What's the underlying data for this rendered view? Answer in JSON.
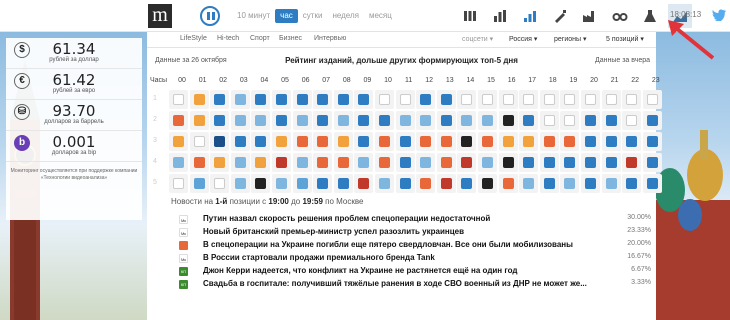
{
  "logo": "m",
  "periods": [
    "10 минут",
    "час",
    "сутки",
    "неделя",
    "месяц"
  ],
  "active_period": "час",
  "toolbar_icons": [
    "grid-icon",
    "bars-icon",
    "bars-blue-icon",
    "brush-icon",
    "factory-icon",
    "glasses-icon",
    "flask-icon",
    "chart-icon"
  ],
  "time": "18:08:13",
  "currency": [
    {
      "icon": "$",
      "value": "61.34",
      "desc": "рублей за доллар"
    },
    {
      "icon": "€",
      "value": "61.42",
      "desc": "рублей за евро"
    },
    {
      "icon": "⛁",
      "value": "93.70",
      "desc": "долларов за баррель"
    },
    {
      "icon": "b",
      "value": "0.001",
      "desc": "долларов за bip"
    }
  ],
  "currency_note": "Мониторинг осуществляется при поддержке компании «Технологии видеоанализа»",
  "categories": [
    "LifeStyle",
    "Hi-tech",
    "Спорт",
    "Бизнес",
    "Интервью"
  ],
  "filters": {
    "social": "соцсети",
    "country": "Россия",
    "regions": "регионы",
    "positions": "5 позиций"
  },
  "data_left": "Данные за 26 октября",
  "rating_title": "Рейтинг изданий, дольше других формирующих топ-5 дня",
  "data_right": "Данные за вчера",
  "hours_label": "Часы",
  "hours": [
    "00",
    "01",
    "02",
    "03",
    "04",
    "05",
    "06",
    "07",
    "08",
    "09",
    "10",
    "11",
    "12",
    "13",
    "14",
    "15",
    "16",
    "17",
    "18",
    "19",
    "20",
    "21",
    "22",
    "23"
  ],
  "row_labels": [
    "1",
    "2",
    "3",
    "4",
    "5"
  ],
  "news_head": {
    "prefix": "Новости на",
    "pos": "1-й",
    "mid": "позиции с",
    "from": "19:00",
    "to_word": "до",
    "to": "19:59",
    "suffix": "по Москве"
  },
  "news": [
    {
      "text": "Путин назвал скорость решения проблем спецоперации недостаточной",
      "pct": "30.00%",
      "color": "#ffffff",
      "icon": "Мк"
    },
    {
      "text": "Новый британский премьер-министр успел разозлить украинцев",
      "pct": "23.33%",
      "color": "#ffffff",
      "icon": "Мк"
    },
    {
      "text": "В спецоперации на Украине погибли еще пятеро свердловчан. Все они были мобилизованы",
      "pct": "20.00%",
      "color": "#e8683a",
      "icon": ""
    },
    {
      "text": "В России стартовали продажи премиального бренда Tank",
      "pct": "16.67%",
      "color": "#ffffff",
      "icon": "Мк"
    },
    {
      "text": "Джон Керри надеется, что конфликт на Украине не растянется ещё на один год",
      "pct": "6.67%",
      "color": "#3d8b2f",
      "icon": "КП"
    },
    {
      "text": "Свадьба в госпитале: получивший тяжёлые ранения в ходе СВО военный из ДНР не может же...",
      "pct": "3.33%",
      "color": "#3d8b2f",
      "icon": "КП"
    }
  ],
  "colors": {
    "accent": "#2e7dc2",
    "selected_icon_bg": "#dde8f2",
    "annotation_arrow": "#e0333a"
  },
  "grid_palette": [
    "#ffffff",
    "#f2a23c",
    "#2e7dc2",
    "#1b4f8a",
    "#7fb6e0",
    "#5ea3d8",
    "#e8683a",
    "#c0392b",
    "#3d8b2f",
    "#222222",
    "#6f6f6f",
    "#e0e0e0"
  ],
  "grid": [
    [
      0,
      1,
      2,
      4,
      2,
      2,
      2,
      2,
      2,
      2,
      0,
      0,
      2,
      2,
      0,
      0,
      0,
      0,
      0,
      0,
      0,
      0,
      0,
      0
    ],
    [
      6,
      1,
      2,
      4,
      4,
      2,
      4,
      2,
      4,
      2,
      2,
      4,
      4,
      2,
      4,
      4,
      9,
      2,
      0,
      0,
      2,
      2,
      0,
      2
    ],
    [
      1,
      0,
      3,
      2,
      2,
      1,
      6,
      6,
      1,
      2,
      6,
      2,
      6,
      6,
      9,
      6,
      1,
      1,
      6,
      6,
      2,
      2,
      2,
      2
    ],
    [
      4,
      6,
      1,
      4,
      1,
      7,
      4,
      6,
      6,
      4,
      6,
      2,
      4,
      6,
      7,
      4,
      9,
      2,
      2,
      2,
      2,
      2,
      7,
      2
    ],
    [
      0,
      5,
      0,
      4,
      9,
      4,
      5,
      2,
      2,
      7,
      4,
      2,
      6,
      7,
      2,
      9,
      6,
      4,
      2,
      4,
      2,
      4,
      2,
      2
    ]
  ]
}
